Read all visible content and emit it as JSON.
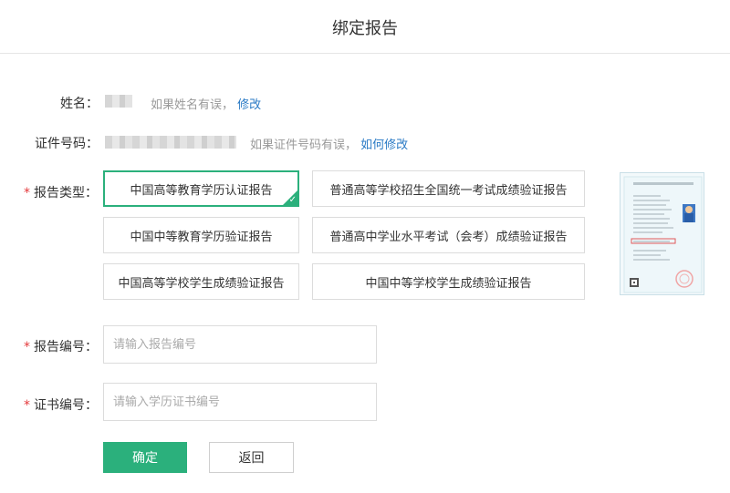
{
  "header": {
    "title": "绑定报告"
  },
  "name_row": {
    "label": "姓名：",
    "hint_prefix": "如果姓名有误，",
    "link": "修改"
  },
  "id_row": {
    "label": "证件号码：",
    "hint_prefix": "如果证件号码有误，",
    "link": "如何修改"
  },
  "report_type": {
    "required_mark": "*",
    "label": "报告类型：",
    "options": [
      "中国高等教育学历认证报告",
      "普通高等学校招生全国统一考试成绩验证报告",
      "中国中等教育学历验证报告",
      "普通高中学业水平考试（会考）成绩验证报告",
      "中国高等学校学生成绩验证报告",
      "中国中等学校学生成绩验证报告"
    ],
    "selected": "中国高等教育学历认证报告"
  },
  "report_number": {
    "required_mark": "*",
    "label": "报告编号：",
    "placeholder": "请输入报告编号"
  },
  "cert_number": {
    "required_mark": "*",
    "label": "证书编号：",
    "placeholder": "请输入学历证书编号"
  },
  "actions": {
    "confirm": "确定",
    "back": "返回"
  },
  "colors": {
    "accent": "#2bb07c",
    "link": "#2a7ac5",
    "required": "#e4393c"
  }
}
